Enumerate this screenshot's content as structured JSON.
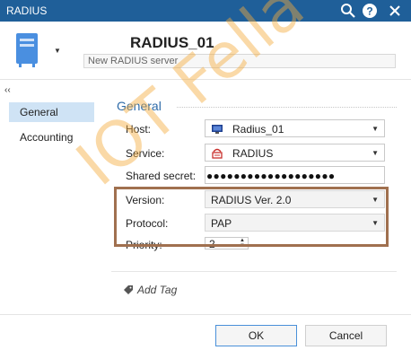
{
  "window": {
    "title": "RADIUS"
  },
  "header": {
    "server_name": "RADIUS_01",
    "description_placeholder": "New RADIUS server"
  },
  "sidebar": {
    "collapse_glyph": "‹‹",
    "items": [
      {
        "label": "General",
        "active": true
      },
      {
        "label": "Accounting",
        "active": false
      }
    ]
  },
  "general": {
    "section_title": "General",
    "host": {
      "label": "Host:",
      "value": "Radius_01"
    },
    "service": {
      "label": "Service:",
      "value": "RADIUS"
    },
    "shared_secret": {
      "label": "Shared secret:",
      "value": "●●●●●●●●●●●●●●●●●●●"
    },
    "version": {
      "label": "Version:",
      "value": "RADIUS Ver. 2.0"
    },
    "protocol": {
      "label": "Protocol:",
      "value": "PAP"
    },
    "priority": {
      "label": "Priority:",
      "value": "2"
    }
  },
  "tags": {
    "add_label": "Add Tag"
  },
  "footer": {
    "ok_label": "OK",
    "cancel_label": "Cancel"
  },
  "watermark": {
    "text": "IOT Fella"
  },
  "colors": {
    "titlebar": "#1f5f99",
    "accent": "#2e6ba8",
    "highlight_border": "#a0704f",
    "sidebar_active": "#cfe3f5"
  },
  "icons": [
    "search-icon",
    "help-icon",
    "close-icon",
    "server-icon",
    "monitor-icon",
    "service-icon",
    "tag-icon"
  ]
}
